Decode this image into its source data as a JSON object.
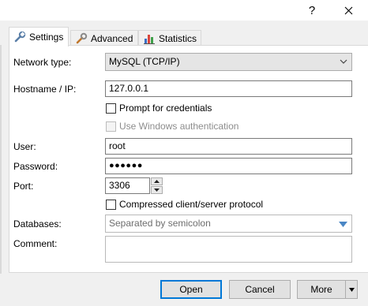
{
  "titlebar": {
    "help": "?",
    "close": "✕"
  },
  "tabs": [
    {
      "label": "Settings",
      "icon": "wrench-icon"
    },
    {
      "label": "Advanced",
      "icon": "wrench-orange-icon"
    },
    {
      "label": "Statistics",
      "icon": "bar-chart-icon"
    }
  ],
  "form": {
    "network_type_label": "Network type:",
    "network_type_value": "MySQL (TCP/IP)",
    "hostname_label": "Hostname / IP:",
    "hostname_value": "127.0.0.1",
    "prompt_credentials": "Prompt for credentials",
    "windows_auth": "Use Windows authentication",
    "user_label": "User:",
    "user_value": "root",
    "password_label": "Password:",
    "password_value": "●●●●●●",
    "port_label": "Port:",
    "port_value": "3306",
    "compressed": "Compressed client/server protocol",
    "databases_label": "Databases:",
    "databases_placeholder": "Separated by semicolon",
    "comment_label": "Comment:"
  },
  "buttons": {
    "open": "Open",
    "cancel": "Cancel",
    "more": "More"
  },
  "colors": {
    "accent": "#0078d7",
    "combo_arrow": "#4a86c5"
  }
}
